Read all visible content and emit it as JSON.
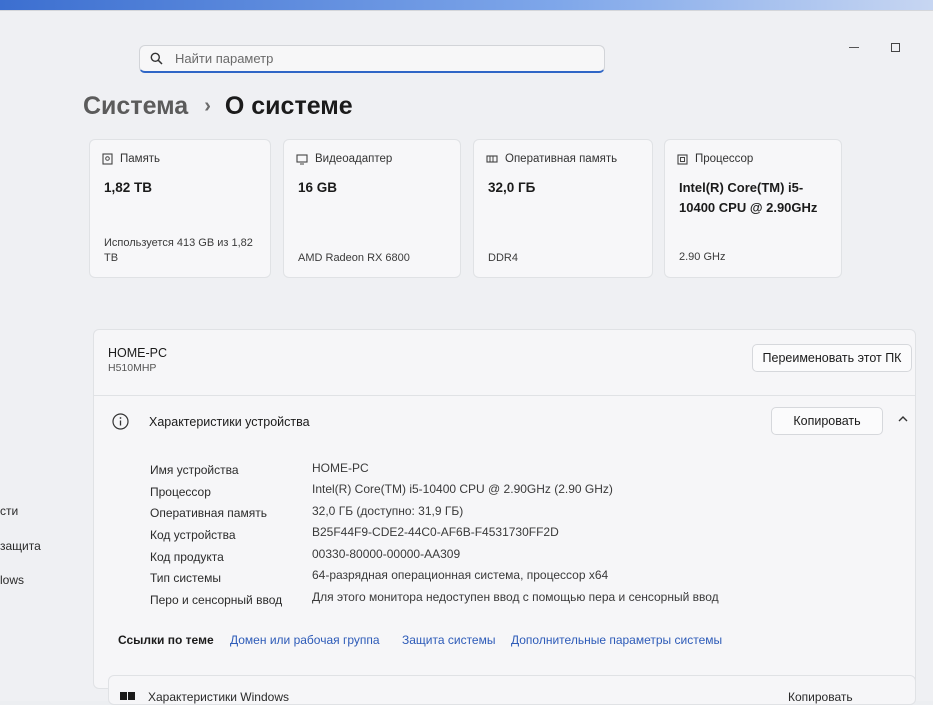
{
  "search": {
    "placeholder": "Найти параметр"
  },
  "breadcrumb": {
    "parent": "Система",
    "separator": "›",
    "current": "О системе"
  },
  "sidebar_fragments": [
    "сти",
    "защита",
    "lows"
  ],
  "cards": [
    {
      "title": "Память",
      "value": "1,82 TB",
      "sub": "Используется 413 GB из 1,82 TB",
      "icon": "storage-icon"
    },
    {
      "title": "Видеоадаптер",
      "value": "16 GB",
      "sub": "AMD Radeon RX 6800",
      "icon": "display-adapter-icon"
    },
    {
      "title": "Оперативная память",
      "value": "32,0 ГБ",
      "sub": "DDR4",
      "icon": "ram-icon"
    },
    {
      "title": "Процессор",
      "value": "Intel(R) Core(TM) i5-10400 CPU @ 2.90GHz",
      "sub": "2.90 GHz",
      "icon": "cpu-icon"
    }
  ],
  "device": {
    "name": "HOME-PC",
    "model": "H510MHP",
    "rename_label": "Переименовать этот ПК"
  },
  "specs": {
    "title": "Характеристики устройства",
    "copy_label": "Копировать",
    "rows": [
      {
        "label": "Имя устройства",
        "value": "HOME-PC"
      },
      {
        "label": "Процессор",
        "value": "Intel(R) Core(TM) i5-10400 CPU @ 2.90GHz (2.90 GHz)"
      },
      {
        "label": "Оперативная память",
        "value": "32,0 ГБ (доступно: 31,9 ГБ)"
      },
      {
        "label": "Код устройства",
        "value": "B25F44F9-CDE2-44C0-AF6B-F4531730FF2D"
      },
      {
        "label": "Код продукта",
        "value": "00330-80000-00000-AA309"
      },
      {
        "label": "Тип системы",
        "value": "64-разрядная операционная система, процессор x64"
      },
      {
        "label": "Перо и сенсорный ввод",
        "value": "Для этого монитора недоступен ввод с помощью пера и сенсорный ввод"
      }
    ]
  },
  "related_links": {
    "title": "Ссылки по теме",
    "items": [
      "Домен или рабочая группа",
      "Защита системы",
      "Дополнительные параметры системы"
    ]
  },
  "windows_section": {
    "title": "Характеристики Windows",
    "copy_label": "Копировать"
  }
}
